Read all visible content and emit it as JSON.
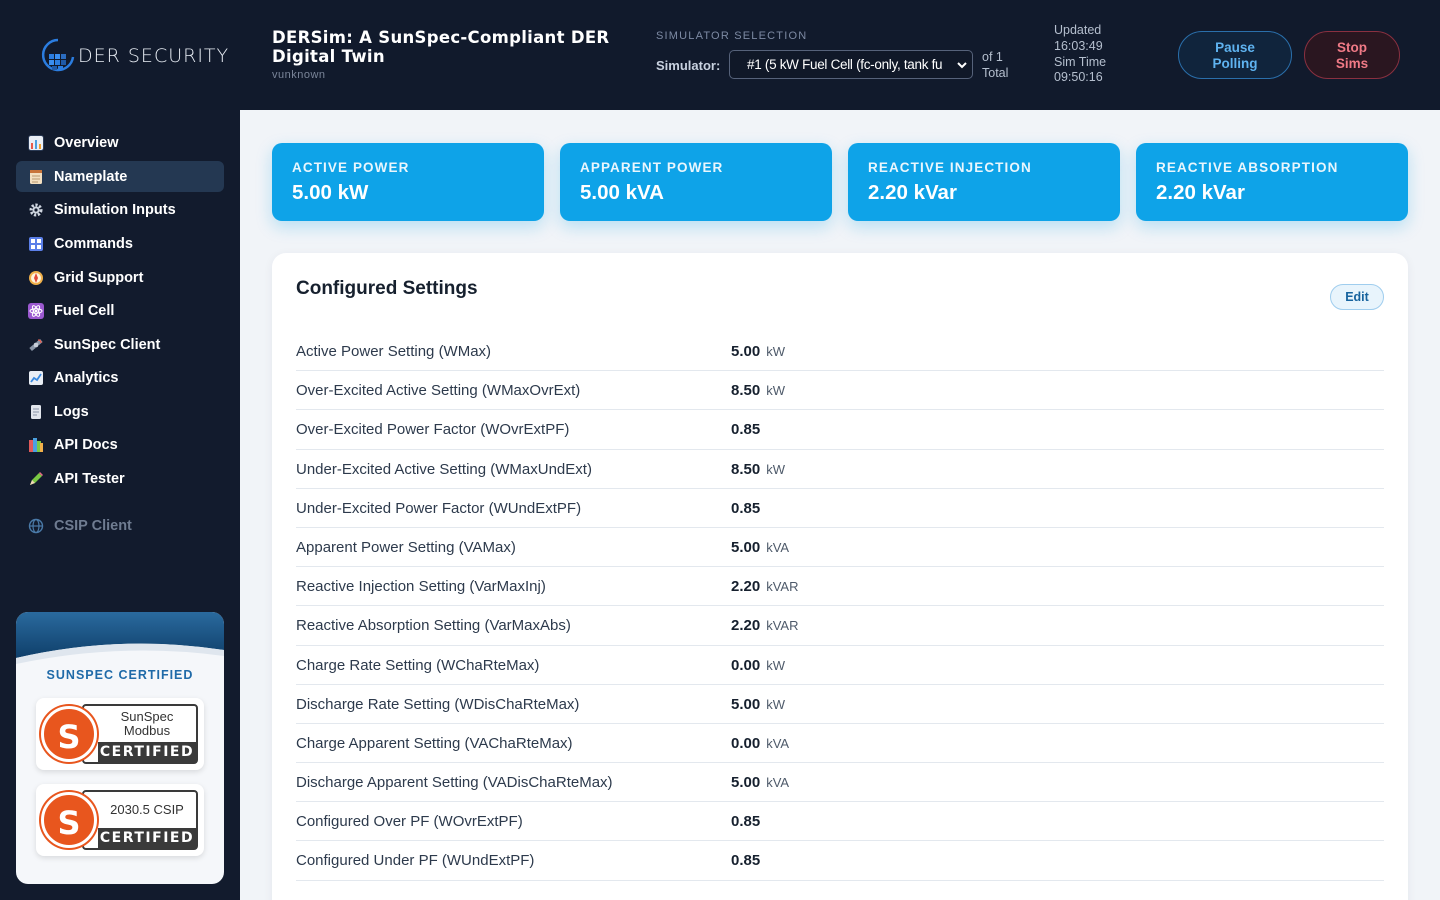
{
  "header": {
    "logo_text": "DER SECURITY",
    "title": "DERSim: A SunSpec-Compliant DER Digital Twin",
    "version": "vunknown",
    "sim_selection_label": "SIMULATOR SELECTION",
    "simulator_label": "Simulator:",
    "simulator_value": "#1 (5 kW Fuel Cell (fc-only, tank fu",
    "of_total_line1": "of 1",
    "of_total_line2": "Total",
    "updated_label": "Updated",
    "updated_time": "16:03:49",
    "sim_time_label": "Sim Time",
    "sim_time": "09:50:16",
    "pause_line1": "Pause",
    "pause_line2": "Polling",
    "stop_line1": "Stop",
    "stop_line2": "Sims"
  },
  "sidebar": {
    "items": [
      {
        "label": "Overview",
        "icon": "chart-icon",
        "color": "#e6a23c"
      },
      {
        "label": "Nameplate",
        "icon": "notepad-icon",
        "color": "#f0d9b5"
      },
      {
        "label": "Simulation Inputs",
        "icon": "gear-icon",
        "color": "#cfd6e0"
      },
      {
        "label": "Commands",
        "icon": "grid-icon",
        "color": "#6b8cf0"
      },
      {
        "label": "Grid Support",
        "icon": "compass-icon",
        "color": "#f0b04a"
      },
      {
        "label": "Fuel Cell",
        "icon": "atom-icon",
        "color": "#9b59d0"
      },
      {
        "label": "SunSpec Client",
        "icon": "satellite-icon",
        "color": "#a8b3c4"
      },
      {
        "label": "Analytics",
        "icon": "line-chart-icon",
        "color": "#5aa0e0"
      },
      {
        "label": "Logs",
        "icon": "document-icon",
        "color": "#d8dde6"
      },
      {
        "label": "API Docs",
        "icon": "books-icon",
        "color": "#e05a5a"
      },
      {
        "label": "API Tester",
        "icon": "pencil-icon",
        "color": "#7ac943"
      },
      {
        "label": "CSIP Client",
        "icon": "globe-icon",
        "color": "#4a7aa8"
      }
    ],
    "cert_title": "SUNSPEC CERTIFIED",
    "badge1_line1": "SunSpec",
    "badge1_line2": "Modbus",
    "badge1_certified": "CERTIFIED",
    "badge2_line1": "2030.5 CSIP",
    "badge2_certified": "CERTIFIED",
    "badge_letter": "S"
  },
  "stats": [
    {
      "label": "ACTIVE POWER",
      "value": "5.00 kW"
    },
    {
      "label": "APPARENT POWER",
      "value": "5.00 kVA"
    },
    {
      "label": "REACTIVE INJECTION",
      "value": "2.20 kVar"
    },
    {
      "label": "REACTIVE ABSORPTION",
      "value": "2.20 kVar"
    }
  ],
  "settings": {
    "title": "Configured Settings",
    "edit_label": "Edit",
    "rows": [
      {
        "name": "Active Power Setting (WMax)",
        "value": "5.00",
        "unit": "kW"
      },
      {
        "name": "Over-Excited Active Setting (WMaxOvrExt)",
        "value": "8.50",
        "unit": "kW"
      },
      {
        "name": "Over-Excited Power Factor (WOvrExtPF)",
        "value": "0.85",
        "unit": ""
      },
      {
        "name": "Under-Excited Active Setting (WMaxUndExt)",
        "value": "8.50",
        "unit": "kW"
      },
      {
        "name": "Under-Excited Power Factor (WUndExtPF)",
        "value": "0.85",
        "unit": ""
      },
      {
        "name": "Apparent Power Setting (VAMax)",
        "value": "5.00",
        "unit": "kVA"
      },
      {
        "name": "Reactive Injection Setting (VarMaxInj)",
        "value": "2.20",
        "unit": "kVAR"
      },
      {
        "name": "Reactive Absorption Setting (VarMaxAbs)",
        "value": "2.20",
        "unit": "kVAR"
      },
      {
        "name": "Charge Rate Setting (WChaRteMax)",
        "value": "0.00",
        "unit": "kW"
      },
      {
        "name": "Discharge Rate Setting (WDisChaRteMax)",
        "value": "5.00",
        "unit": "kW"
      },
      {
        "name": "Charge Apparent Setting (VAChaRteMax)",
        "value": "0.00",
        "unit": "kVA"
      },
      {
        "name": "Discharge Apparent Setting (VADisChaRteMax)",
        "value": "5.00",
        "unit": "kVA"
      },
      {
        "name": "Configured Over PF (WOvrExtPF)",
        "value": "0.85",
        "unit": ""
      },
      {
        "name": "Configured Under PF (WUndExtPF)",
        "value": "0.85",
        "unit": ""
      }
    ]
  }
}
